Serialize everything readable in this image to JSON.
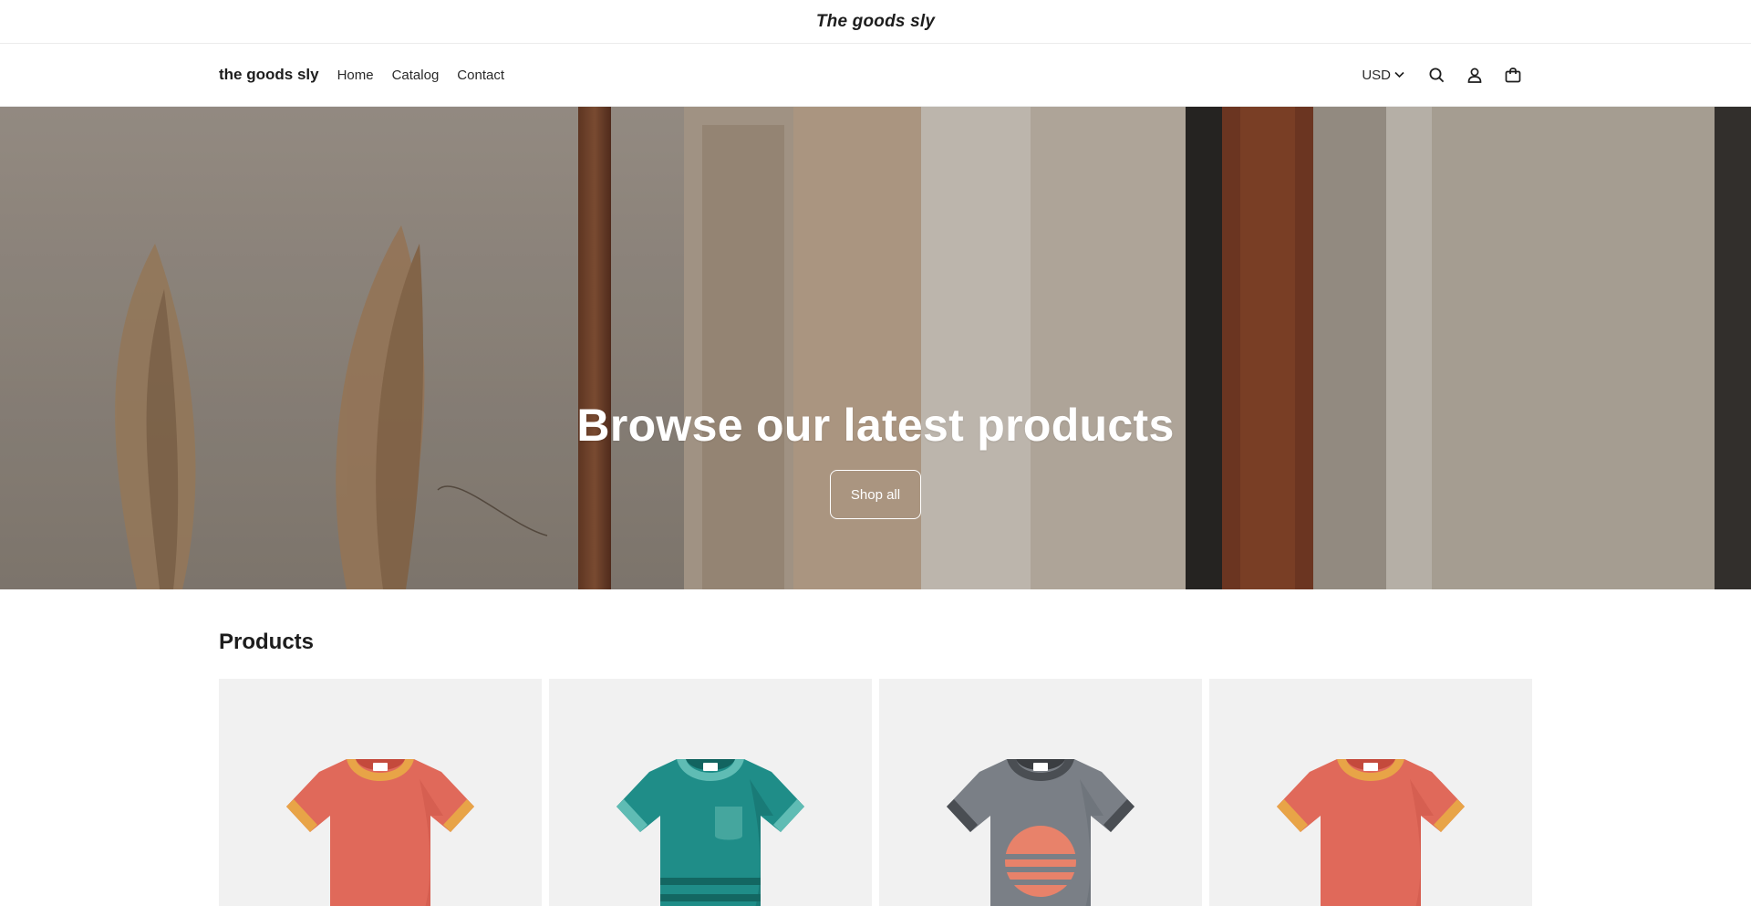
{
  "announcement": {
    "text": "The goods sly"
  },
  "header": {
    "logo": "the goods sly",
    "nav": [
      "Home",
      "Catalog",
      "Contact"
    ],
    "currency": "USD",
    "icons": [
      "search-icon",
      "account-icon",
      "cart-icon"
    ]
  },
  "hero": {
    "title": "Browse our latest products",
    "button": "Shop all"
  },
  "products": {
    "title": "Products",
    "items": [
      {
        "image": "orange t-shirt",
        "color": "#e0695a",
        "trim": "#e8a447"
      },
      {
        "image": "teal pocket t-shirt",
        "color": "#1f8d88",
        "trim": "#5fbcb4"
      },
      {
        "image": "gray t-shirt with sunset",
        "color": "#7a7f86",
        "trim": "#4a4e53"
      },
      {
        "image": "orange t-shirt",
        "color": "#e0695a",
        "trim": "#e8a447"
      }
    ]
  }
}
